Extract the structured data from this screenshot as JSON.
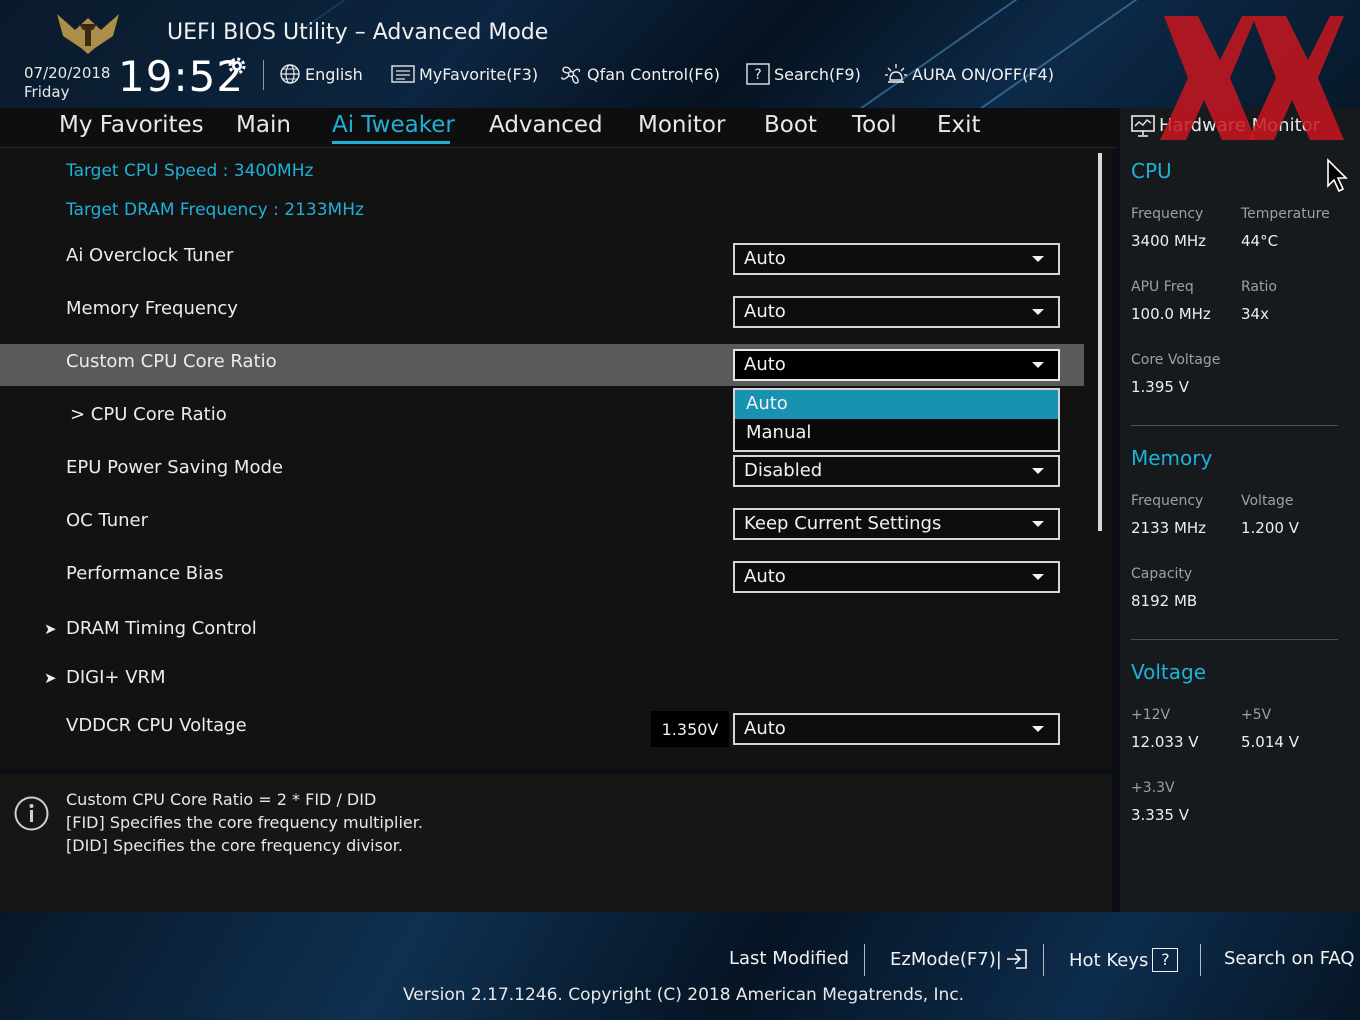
{
  "header": {
    "title": "UEFI BIOS Utility – Advanced Mode",
    "date": "07/20/2018",
    "day": "Friday",
    "time": "19:52",
    "buttons": {
      "language": "English",
      "my_favorite": "MyFavorite(F3)",
      "qfan": "Qfan Control(F6)",
      "search": "Search(F9)",
      "aura": "AURA ON/OFF(F4)"
    }
  },
  "nav": {
    "tabs": [
      "My Favorites",
      "Main",
      "Ai Tweaker",
      "Advanced",
      "Monitor",
      "Boot",
      "Tool",
      "Exit"
    ],
    "active": "Ai Tweaker"
  },
  "main": {
    "target_cpu": "Target CPU Speed : 3400MHz",
    "target_dram": "Target DRAM Frequency : 2133MHz",
    "settings": [
      {
        "label": "Ai Overclock Tuner",
        "value": "Auto"
      },
      {
        "label": "Memory Frequency",
        "value": "Auto"
      },
      {
        "label": "Custom CPU Core Ratio",
        "value": "Auto"
      },
      {
        "label": "> CPU Core Ratio",
        "value": ""
      },
      {
        "label": "EPU Power Saving Mode",
        "value": "Disabled"
      },
      {
        "label": "OC Tuner",
        "value": "Keep Current Settings"
      },
      {
        "label": "Performance Bias",
        "value": "Auto"
      },
      {
        "label": "DRAM Timing Control",
        "value": ""
      },
      {
        "label": "DIGI+ VRM",
        "value": ""
      },
      {
        "label": "VDDCR CPU Voltage",
        "value": "Auto",
        "reading": "1.350V"
      }
    ],
    "popup_options": [
      "Auto",
      "Manual"
    ],
    "popup_selected": "Auto",
    "submenu_arrow": "➤"
  },
  "help": {
    "lines": [
      "Custom CPU Core Ratio = 2 * FID / DID",
      "[FID] Specifies the core frequency multiplier.",
      "[DID] Specifies the core frequency divisor."
    ]
  },
  "hardware_monitor": {
    "title": "Hardware Monitor",
    "cpu": {
      "heading": "CPU",
      "frequency_label": "Frequency",
      "frequency": "3400 MHz",
      "temperature_label": "Temperature",
      "temperature": "44°C",
      "apu_freq_label": "APU Freq",
      "apu_freq": "100.0 MHz",
      "ratio_label": "Ratio",
      "ratio": "34x",
      "core_voltage_label": "Core Voltage",
      "core_voltage": "1.395 V"
    },
    "memory": {
      "heading": "Memory",
      "frequency_label": "Frequency",
      "frequency": "2133 MHz",
      "voltage_label": "Voltage",
      "voltage": "1.200 V",
      "capacity_label": "Capacity",
      "capacity": "8192 MB"
    },
    "voltage": {
      "heading": "Voltage",
      "v12_label": "+12V",
      "v12": "12.033 V",
      "v5_label": "+5V",
      "v5": "5.014 V",
      "v33_label": "+3.3V",
      "v33": "3.335 V"
    }
  },
  "footer": {
    "last_modified": "Last Modified",
    "ezmode": "EzMode(F7)|",
    "hot_keys": "Hot Keys",
    "hot_keys_key": "?",
    "search_faq": "Search on FAQ",
    "version": "Version 2.17.1246. Copyright (C) 2018 American Megatrends, Inc."
  },
  "colors": {
    "accent": "#1fb0d8",
    "popup_selected": "#1892b0",
    "highlight_row": "#5a5a5a",
    "watermark": "#c8161e"
  }
}
